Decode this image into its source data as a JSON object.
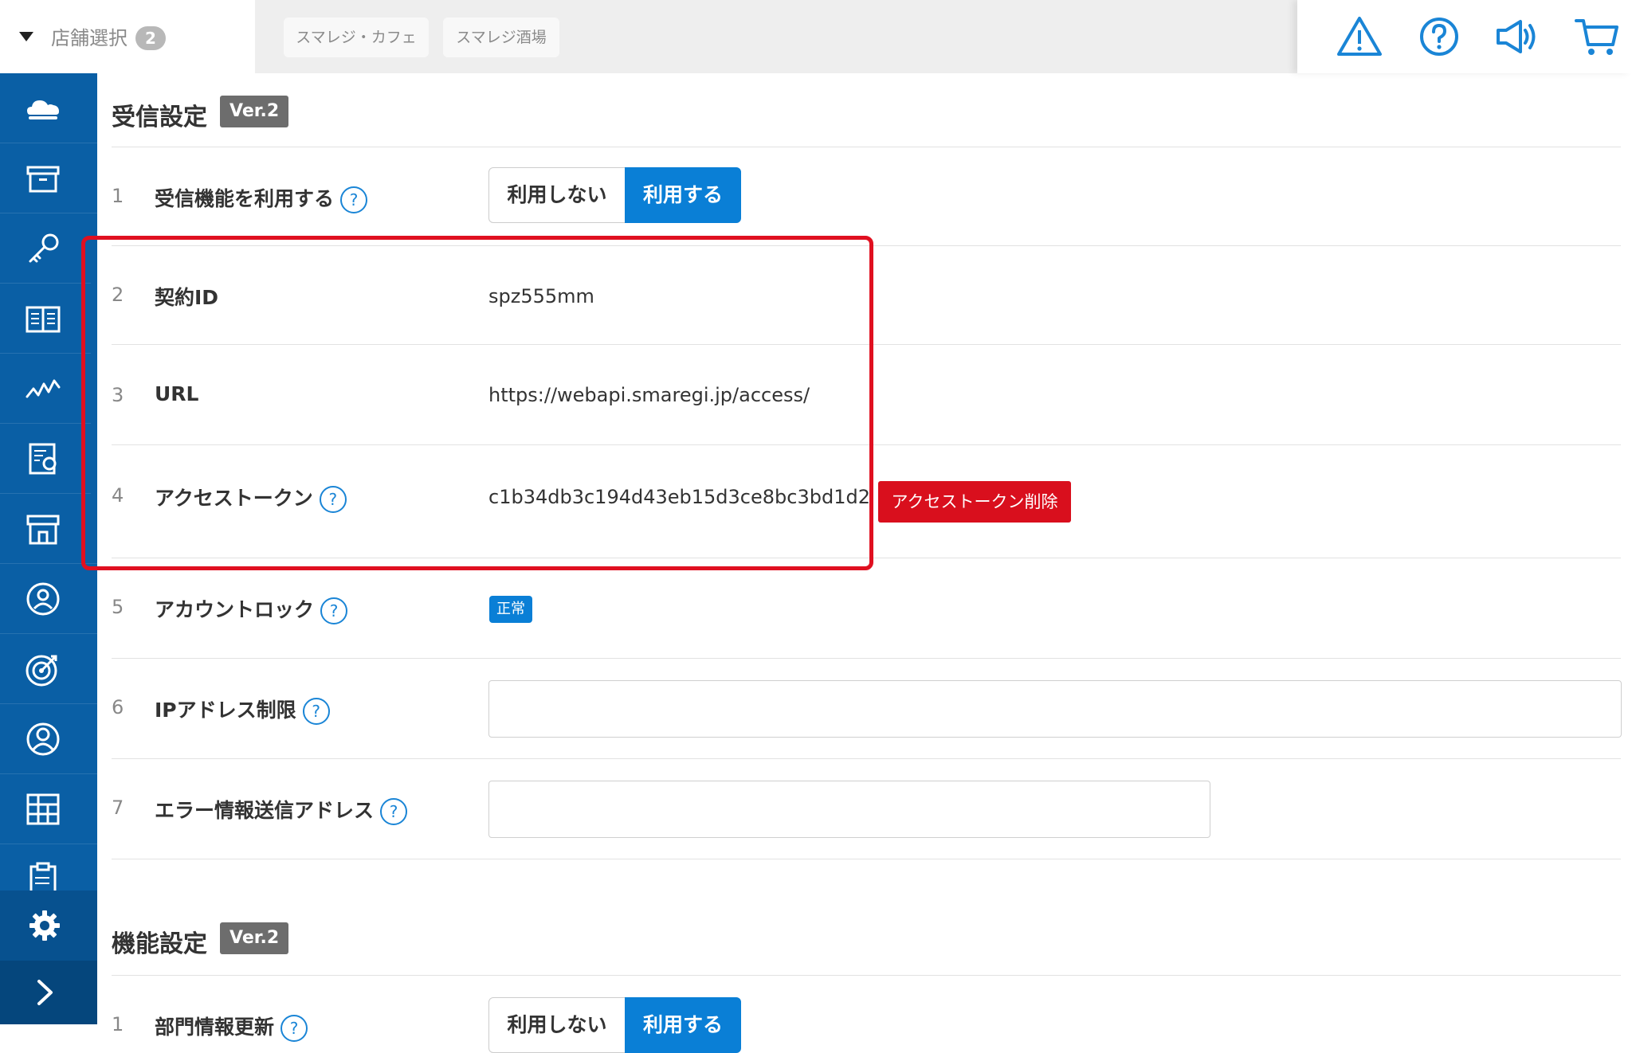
{
  "header": {
    "store_select_label": "店舗選択",
    "store_count": "2",
    "store_tabs": [
      "スマレジ・カフェ",
      "スマレジ酒場"
    ],
    "icons": [
      "warning-icon",
      "help-icon",
      "megaphone-icon",
      "cart-icon"
    ]
  },
  "sidebar": {
    "icons": [
      "cloud-icon",
      "archive-icon",
      "key-icon",
      "book-icon",
      "chart-line-icon",
      "report-icon",
      "store-icon",
      "customer-icon",
      "target-icon",
      "user-icon",
      "grid-icon",
      "clipboard-icon",
      "gear-icon",
      "chevron-right-icon"
    ]
  },
  "receive_section": {
    "title": "受信設定",
    "version": "Ver.2",
    "rows": [
      {
        "num": "1",
        "label": "受信機能を利用する",
        "option_off": "利用しない",
        "option_on": "利用する",
        "selected": "利用する"
      },
      {
        "num": "2",
        "label": "契約ID",
        "value": "spz555mm"
      },
      {
        "num": "3",
        "label": "URL",
        "value": "https://webapi.smaregi.jp/access/"
      },
      {
        "num": "4",
        "label": "アクセストークン",
        "value": "c1b34db3c194d43eb15d3ce8bc3bd1d2",
        "action": "アクセストークン削除"
      },
      {
        "num": "5",
        "label": "アカウントロック",
        "status": "正常"
      },
      {
        "num": "6",
        "label": "IPアドレス制限",
        "input_value": ""
      },
      {
        "num": "7",
        "label": "エラー情報送信アドレス",
        "input_value": ""
      }
    ],
    "help_marker": "?"
  },
  "function_section": {
    "title": "機能設定",
    "version": "Ver.2",
    "rows": [
      {
        "num": "1",
        "label": "部門情報更新",
        "option_off": "利用しない",
        "option_on": "利用する",
        "selected": "利用する"
      }
    ]
  },
  "colors": {
    "sidebar": "#0a5fa5",
    "accent": "#0a7fd6",
    "highlight": "#e01020",
    "danger": "#d90f1d",
    "icon_blue": "#1a85d6"
  }
}
